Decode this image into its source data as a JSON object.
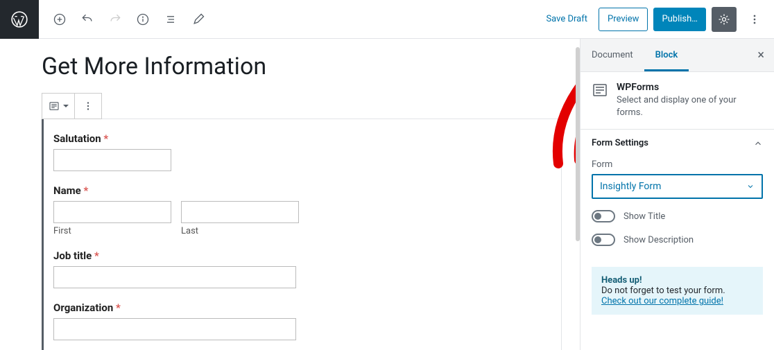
{
  "toolbar": {
    "save_draft": "Save Draft",
    "preview": "Preview",
    "publish": "Publish…"
  },
  "page": {
    "title": "Get More Information"
  },
  "form": {
    "salutation_label": "Salutation",
    "name_label": "Name",
    "first_sub": "First",
    "last_sub": "Last",
    "job_title_label": "Job title",
    "organization_label": "Organization"
  },
  "sidebar": {
    "tabs": {
      "document": "Document",
      "block": "Block"
    },
    "block_header": {
      "title": "WPForms",
      "desc": "Select and display one of your forms."
    },
    "panel_title": "Form Settings",
    "form_label": "Form",
    "form_selected": "Insightly Form",
    "show_title": "Show Title",
    "show_desc": "Show Description",
    "notice": {
      "heads": "Heads up!",
      "line": "Do not forget to test your form.",
      "link": "Check out our complete guide!"
    }
  }
}
